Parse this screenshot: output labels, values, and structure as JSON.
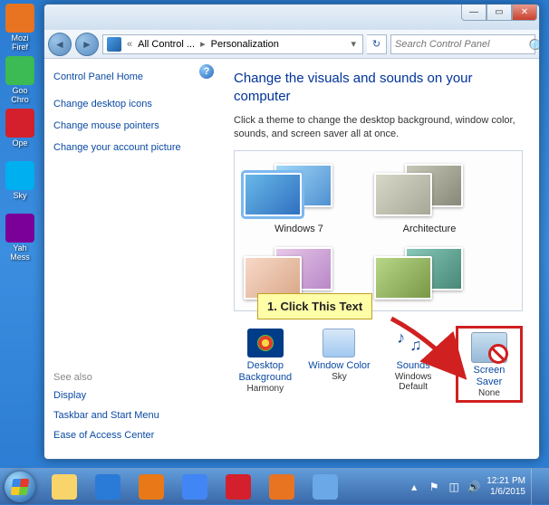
{
  "desktop": {
    "icons": [
      {
        "label": "Mozi\nFiref",
        "color": "#e87422"
      },
      {
        "label": "Goo\nChro",
        "color": "#3cba54"
      },
      {
        "label": "Ope",
        "color": "#d4202c"
      },
      {
        "label": "Sky",
        "color": "#00aff0"
      },
      {
        "label": "Yah\nMess",
        "color": "#7b0099"
      }
    ]
  },
  "window": {
    "breadcrumb": {
      "root": "All Control ...",
      "current": "Personalization"
    },
    "search_placeholder": "Search Control Panel",
    "sidebar": {
      "home": "Control Panel Home",
      "links": [
        "Change desktop icons",
        "Change mouse pointers",
        "Change your account picture"
      ],
      "see_also_hdr": "See also",
      "see_also": [
        "Display",
        "Taskbar and Start Menu",
        "Ease of Access Center"
      ]
    },
    "main": {
      "title": "Change the visuals and sounds on your computer",
      "desc": "Click a theme to change the desktop background, window color, sounds, and screen saver all at once.",
      "themes": [
        {
          "name": "Windows 7",
          "selected": true
        },
        {
          "name": "Architecture"
        }
      ],
      "settings": {
        "desktop_bg": {
          "label": "Desktop Background",
          "value": "Harmony"
        },
        "window_color": {
          "label": "Window Color",
          "value": "Sky"
        },
        "sounds": {
          "label": "Sounds",
          "value": "Windows Default"
        },
        "screen_saver": {
          "label": "Screen Saver",
          "value": "None"
        }
      }
    }
  },
  "annotation": {
    "text": "1. Click This Text"
  },
  "taskbar": {
    "items": [
      {
        "name": "explorer",
        "color": "#f8d46a"
      },
      {
        "name": "ie",
        "color": "#2a7bd8"
      },
      {
        "name": "wmp",
        "color": "#e87818"
      },
      {
        "name": "chrome",
        "color": "#4285f4"
      },
      {
        "name": "opera",
        "color": "#d4202c"
      },
      {
        "name": "firefox",
        "color": "#e87422"
      },
      {
        "name": "control-panel",
        "color": "#6aa8e8"
      }
    ],
    "clock": {
      "time": "12:21 PM",
      "date": "1/6/2015"
    }
  }
}
